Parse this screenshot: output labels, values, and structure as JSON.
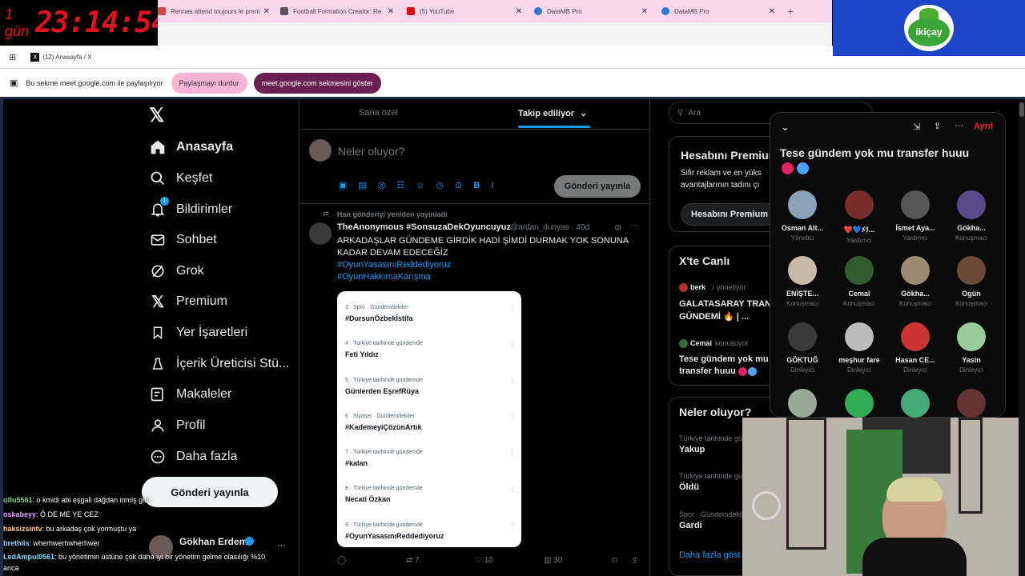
{
  "overlay": {
    "days": "1 gün",
    "clock": "23:14:54"
  },
  "tabs": [
    {
      "title": "Rennes attend toujours le prem",
      "color": "#d44"
    },
    {
      "title": "Football Formation Creator: Re",
      "color": "#555"
    },
    {
      "title": "(5) YouTube",
      "color": "#e00"
    },
    {
      "title": "DataMB Pro",
      "color": "#2a7bd6"
    },
    {
      "title": "DataMB Pro",
      "color": "#2a7bd6"
    }
  ],
  "new_tab": "+",
  "window_tab": "(12) Anasayfa / X",
  "logo_text": "ikiçay",
  "share": {
    "text": "Bu sekme meet.google.com ile paylaşılıyor",
    "stop": "Paylaşmayı durdur",
    "show": "meet.google.com sekmesini göster"
  },
  "nav": {
    "items": [
      {
        "label": "Anasayfa",
        "icon": "home-icon"
      },
      {
        "label": "Keşfet",
        "icon": "search-icon"
      },
      {
        "label": "Bildirimler",
        "icon": "bell-icon"
      },
      {
        "label": "Sohbet",
        "icon": "mail-icon"
      },
      {
        "label": "Grok",
        "icon": "grok-icon"
      },
      {
        "label": "Premium",
        "icon": "x-icon"
      },
      {
        "label": "Yer İşaretleri",
        "icon": "bookmark-icon"
      },
      {
        "label": "İçerik Üreticisi Stü...",
        "icon": "creator-icon"
      },
      {
        "label": "Makaleler",
        "icon": "article-icon"
      },
      {
        "label": "Profil",
        "icon": "profile-icon"
      },
      {
        "label": "Daha fazla",
        "icon": "more-icon"
      }
    ],
    "badge": "1",
    "post_button": "Gönderi yayınla",
    "user": "Gökhan Erdem",
    "dots": "···"
  },
  "timeline": {
    "tab_foryou": "Sana özel",
    "tab_following": "Takip ediliyor",
    "compose_placeholder": "Neler oluyor?",
    "compose_button": "Gönderi yayınla",
    "repost_note": "Han gönderiyi yeniden yayınladı",
    "tweet": {
      "author": "TheAnonymous #SonsuzaDekOyuncuyuz",
      "handle": "@ardan_dunyas · 40d",
      "text": "ARKADAŞLAR GÜNDEME GİRDİK HADİ ŞİMDİ DURMAK YOK SONUNA KADAR DEVAM EDECEĞİZ",
      "tag1": "#OyunYasasınıReddediyoruz",
      "tag2": "#OyunHakkımaKarışma",
      "dots": "···",
      "stats": {
        "replies": "",
        "reposts": "7",
        "likes": "10",
        "views": "30"
      }
    },
    "trends": [
      {
        "meta": "3 · Spor · Gündemdekiler",
        "name": "#DursunÖzbekİstifa"
      },
      {
        "meta": "4 · Türkiye tarihinde gündemde",
        "name": "Feti Yıldız"
      },
      {
        "meta": "5 · Türkiye tarihinde gündemde",
        "name": "Günlerden EşrefRüya"
      },
      {
        "meta": "6 · Siyaset · Gündemdekiler",
        "name": "#KademeyiÇözünArtık"
      },
      {
        "meta": "7 · Türkiye tarihinde gündemde",
        "name": "#kalan"
      },
      {
        "meta": "8 · Türkiye tarihinde gündemde",
        "name": "Necati Özkan"
      },
      {
        "meta": "9 · Türkiye tarihinde gündemde",
        "name": "#OyunYasasınıReddediyoruz"
      }
    ]
  },
  "right": {
    "search_placeholder": "Ara",
    "premium_title": "Hesabını Premium",
    "premium_text1": "Sifir reklam ve en yüks",
    "premium_text2": "avantajlarının tadını çı",
    "premium_button": "Hesabını Premium",
    "live_title": "X'te Canlı",
    "live1_host": "berk",
    "live1_status": "yönetiyor",
    "live1_title1": "GALATASARAY TRANS",
    "live1_title2": "GÜNDEMİ 🔥 | ...",
    "live2_host": "Cemal",
    "live2_status": "konuşuyor",
    "live2_title1": "Tese gündem yok mu",
    "live2_title2": "transfer huuu",
    "whats_title": "Neler oluyor?",
    "whats": [
      {
        "meta": "Türkiye tarihinde gü",
        "name": "Yakup"
      },
      {
        "meta": "Türkiye tarihinde gü",
        "name": "Öldü"
      },
      {
        "meta": "Spor · Gündemdekil",
        "name": "Gardi"
      }
    ],
    "more": "Daha fazla göst"
  },
  "space": {
    "leave": "Ayrıl",
    "title": "Tese gündem yok mu transfer huuu",
    "people": [
      {
        "name": "Osman Alt...",
        "role": "Yönetici",
        "color": "#8aa0b8"
      },
      {
        "name": "❤️💙ﾒﾘ...",
        "role": "Yardımcı",
        "color": "#7a2b2b"
      },
      {
        "name": "İsmet Aya...",
        "role": "Yardımcı",
        "color": "#555"
      },
      {
        "name": "Gökha...",
        "role": "Konuşmacı",
        "color": "#5a4a8a"
      },
      {
        "name": "ENİŞTE...",
        "role": "Konuşmacı",
        "color": "#c9b9a8"
      },
      {
        "name": "Cemal",
        "role": "Konuşmacı",
        "color": "#2f5d2f"
      },
      {
        "name": "Gökha...",
        "role": "Konuşmacı",
        "color": "#9a8a70"
      },
      {
        "name": "Ogün",
        "role": "Konuşmacı",
        "color": "#6b4a3a"
      },
      {
        "name": "GÖKTUĞ",
        "role": "Dinleyici",
        "color": "#3a3a3a"
      },
      {
        "name": "meşhur fare",
        "role": "Dinleyici",
        "color": "#bbb"
      },
      {
        "name": "Hasan CE...",
        "role": "Dinleyici",
        "color": "#c33"
      },
      {
        "name": "Yasin",
        "role": "Dinleyici",
        "color": "#9c9"
      }
    ]
  },
  "chat": [
    {
      "user": "oflu5561",
      "msg": ": o kmidi abi eşgali dağdan inmiş gibi",
      "color": "#7fd37f"
    },
    {
      "user": "oskabeyy",
      "msg": ": Ö DE ME YE CEZ",
      "color": "#e0a0ff"
    },
    {
      "user": "haksizsintv",
      "msg": ": bu arkadaş çok yormuştu ya",
      "color": "#ffd27f"
    },
    {
      "user": "brethils",
      "msg": ": wherhwerhwherhwer",
      "color": "#9fd0ff"
    },
    {
      "user": "LedAmpul0561",
      "msg": ": bu yönetimin üstüne çok daha iyi bir yönetim gelme olasılığı %10",
      "color": "#7fdfff"
    },
    {
      "user": "",
      "msg": "anca",
      "color": "#fff"
    }
  ]
}
